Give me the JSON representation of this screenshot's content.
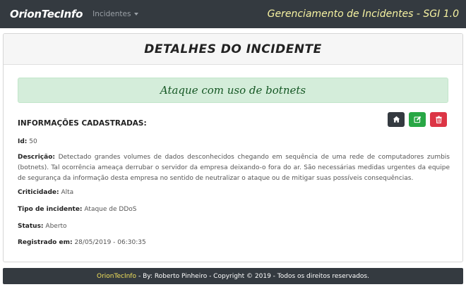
{
  "navbar": {
    "brand": "OrionTecInfo",
    "menu_label": "Incidentes",
    "title": "Gerenciamento de Incidentes - SGI 1.0"
  },
  "header": {
    "title": "DETALHES DO INCIDENTE"
  },
  "incident": {
    "name": "Ataque com uso de botnets",
    "section_title": "INFORMAÇÕES CADASTRADAS:",
    "id_label": "Id:",
    "id_value": "50",
    "desc_label": "Descrição:",
    "desc_value": "Detectado grandes volumes de dados desconhecidos chegando em sequência de uma rede de computadores zumbis (botnets). Tal ocorrência ameaça derrubar o servidor da empresa deixando-o fora do ar. São necessárias medidas urgentes da equipe de segurança da informação desta empresa no sentido de neutralizar o ataque ou de mitigar suas possíveis consequências.",
    "criticality_label": "Criticidade:",
    "criticality_value": "Alta",
    "type_label": "Tipo de incidente:",
    "type_value": "Ataque de DDoS",
    "status_label": "Status:",
    "status_value": "Aberto",
    "registered_label": "Registrado em:",
    "registered_value": "28/05/2019 - 06:30:35"
  },
  "actions": [
    {
      "icon": "home-icon",
      "color": "#343a40"
    },
    {
      "icon": "edit-icon",
      "color": "#28a745"
    },
    {
      "icon": "trash-icon",
      "color": "#dc3545"
    }
  ],
  "footer": {
    "brand": "OrionTecInfo",
    "text": "- By: Roberto Pinheiro - Copyright © 2019 - Todos os direitos reservados."
  }
}
